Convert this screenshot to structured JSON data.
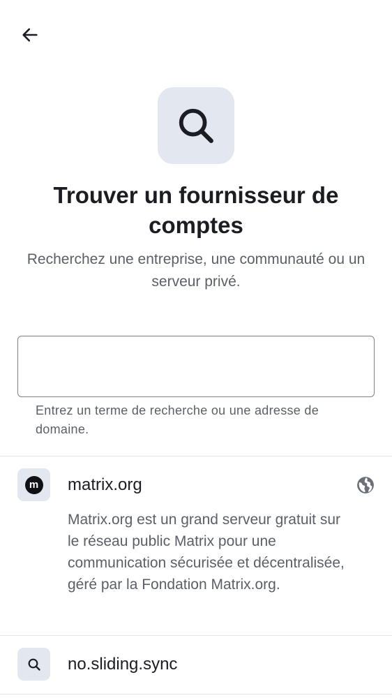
{
  "header": {
    "back_icon": "arrow-left-icon"
  },
  "hero": {
    "icon": "search-icon",
    "title": "Trouver un fournisseur de comptes",
    "subtitle": "Recherchez une entreprise, une communauté ou un serveur privé."
  },
  "search": {
    "value": "",
    "placeholder": "",
    "helper": "Entrez un terme de recherche ou une adresse de domaine."
  },
  "providers": [
    {
      "name": "matrix.org",
      "icon": "matrix-logo-icon",
      "logo_letter": "m",
      "description": "Matrix.org est un grand serveur gratuit sur le réseau public Matrix pour une communication sécurisée et décentralisée, géré par la Fondation Matrix.org.",
      "badge_icon": "globe-icon"
    },
    {
      "name": "no.sliding.sync",
      "icon": "search-icon"
    }
  ],
  "colors": {
    "icon_bg": "#e3e7ef",
    "text_primary": "#1b1d22",
    "text_secondary": "#5b6068",
    "divider": "#e3e6ea",
    "border": "#7b8089"
  }
}
